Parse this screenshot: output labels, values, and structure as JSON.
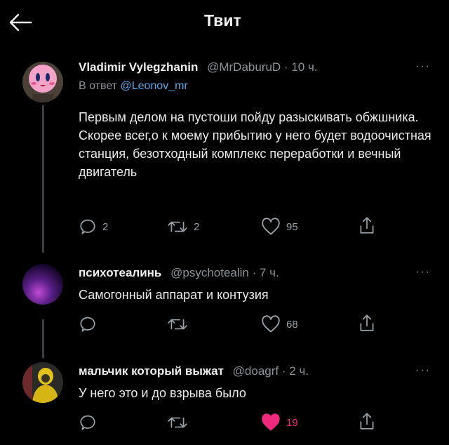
{
  "header": {
    "title": "Твит"
  },
  "tweets": [
    {
      "name": "Vladimir Vylegzhanin",
      "meta": "@MrDaburuD · 10 ч.",
      "reply_prefix": "В ответ",
      "reply_to": "@Leonov_mr",
      "text": "Первым делом на пустоши пойду разыскивать обжшника. Скорее всег,о к моему прибытию у него будет водоочистная станция, безотходный комплекс переработки и вечный двигатель",
      "replies": "2",
      "retweets": "2",
      "likes": "95",
      "liked": false
    },
    {
      "name": "психотеалинь",
      "meta": "@psychotealin · 7 ч.",
      "text": "Самогонный аппарат и контузия",
      "replies": "",
      "retweets": "",
      "likes": "68",
      "liked": false
    },
    {
      "name": "мальчик который выжат",
      "meta": "@doagrf · 2 ч.",
      "text": "У него это и до взрыва было",
      "replies": "",
      "retweets": "",
      "likes": "19",
      "liked": true
    }
  ],
  "more_label": "···",
  "colors": {
    "like_active": "#f1297c",
    "link": "#5aa7e6",
    "muted": "#8b9298"
  },
  "icons": [
    "back-arrow-icon",
    "reply-icon",
    "retweet-icon",
    "like-icon",
    "share-icon"
  ]
}
